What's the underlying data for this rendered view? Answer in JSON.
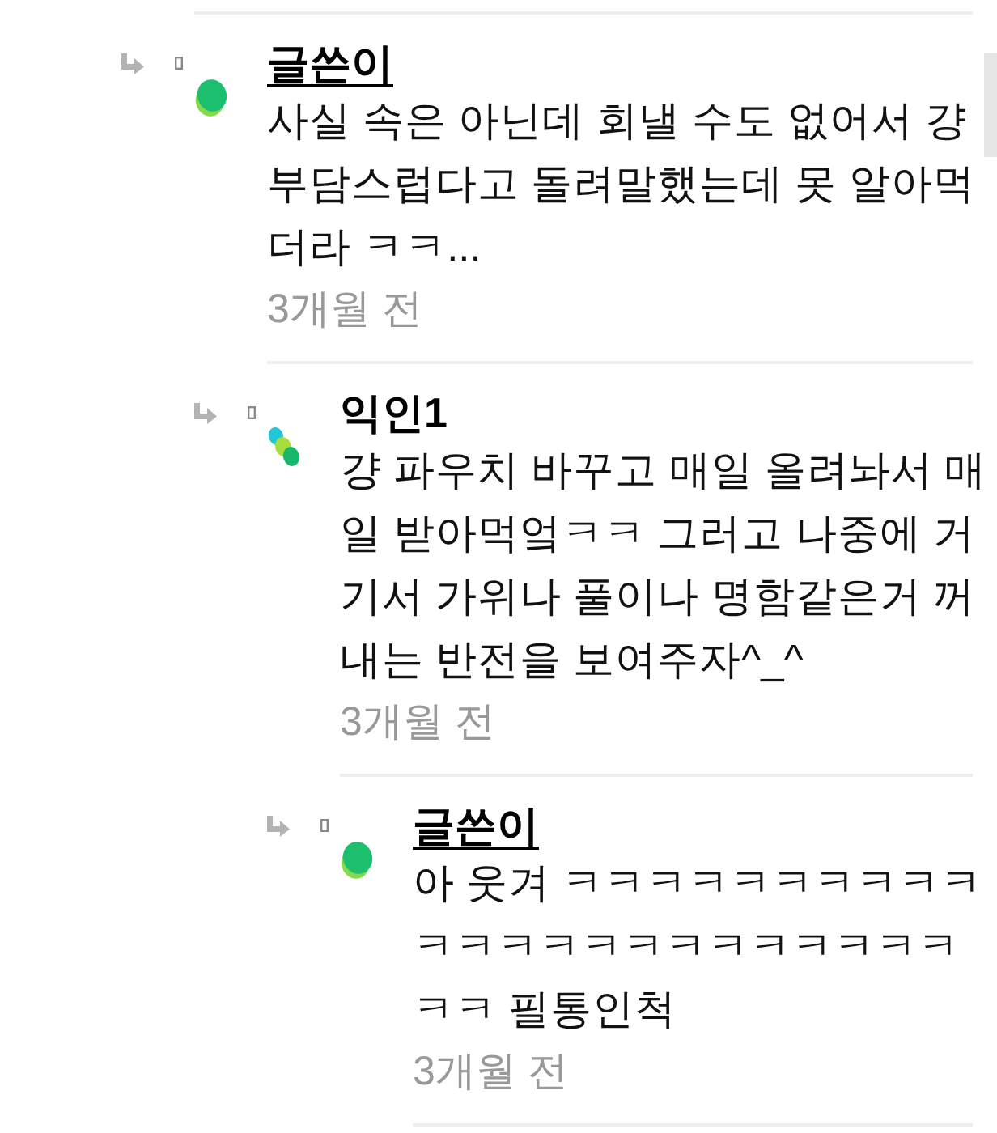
{
  "comments": [
    {
      "author": "글쓴이",
      "linked": true,
      "avatar": {
        "kind": "blob"
      },
      "text": "사실 속은 아닌데 회낼 수도 없어서 걍 부담스럽다고 돌려말했는데 못 알아먹더라 ㅋㅋ...",
      "time": "3개월 전",
      "children": [
        {
          "author": "익인1",
          "linked": false,
          "avatar": {
            "kind": "dots"
          },
          "text": "걍 파우치 바꾸고 매일 올려놔서 매일 받아먹엌ㅋㅋ 그러고 나중에 거기서 가위나 풀이나 명함같은거 꺼내는 반전을 보여주자^_^",
          "time": "3개월 전",
          "children": [
            {
              "author": "글쓴이",
              "linked": true,
              "avatar": {
                "kind": "blob"
              },
              "text": "아 웃겨 ㅋㅋㅋㅋㅋㅋㅋㅋㅋㅋㅋㅋㅋㅋㅋㅋㅋㅋㅋㅋㅋㅋㅋㅋㅋ 필통인척",
              "time": "3개월 전"
            }
          ]
        }
      ]
    }
  ]
}
